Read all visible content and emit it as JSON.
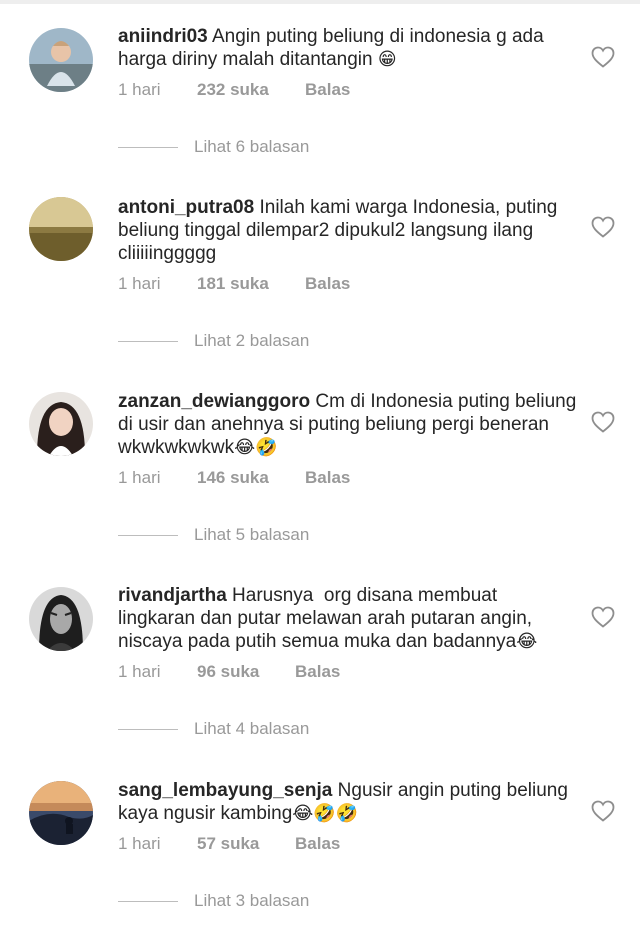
{
  "comments": [
    {
      "username": "aniindri03",
      "text": "Angin puting beliung di indonesia g ada harga diriny malah ditantangin",
      "emoji": "😁",
      "time": "1 hari",
      "likes": "232 suka",
      "reply": "Balas",
      "view_replies": "Lihat 6 balasan"
    },
    {
      "username": "antoni_putra08",
      "text": "Inilah kami warga Indonesia, puting beliung tinggal dilempar2 dipukul2 langsung ilang cliiiiinggggg",
      "emoji": "",
      "time": "1 hari",
      "likes": "181 suka",
      "reply": "Balas",
      "view_replies": "Lihat 2 balasan"
    },
    {
      "username": "zanzan_dewianggoro",
      "text": "Cm di Indonesia puting beliung di usir dan anehnya si puting beliung pergi beneran wkwkwkwkwk",
      "emoji": "😂🤣",
      "time": "1 hari",
      "likes": "146 suka",
      "reply": "Balas",
      "view_replies": "Lihat 5 balasan"
    },
    {
      "username": "rivandjartha",
      "text": "Harusnya  org disana membuat lingkaran dan putar melawan arah putaran angin, niscaya pada putih semua muka dan badannya",
      "emoji": "😂",
      "time": "1 hari",
      "likes": "96 suka",
      "reply": "Balas",
      "view_replies": "Lihat 4 balasan"
    },
    {
      "username": "sang_lembayung_senja",
      "text": "Ngusir angin puting beliung kaya ngusir kambing",
      "emoji": "😂🤣🤣",
      "time": "1 hari",
      "likes": "57 suka",
      "reply": "Balas",
      "view_replies": "Lihat 3 balasan"
    }
  ],
  "icons": {
    "like": "heart-outline-icon"
  },
  "colors": {
    "text": "#262626",
    "meta": "#999999",
    "divider": "#bdbdbd"
  }
}
